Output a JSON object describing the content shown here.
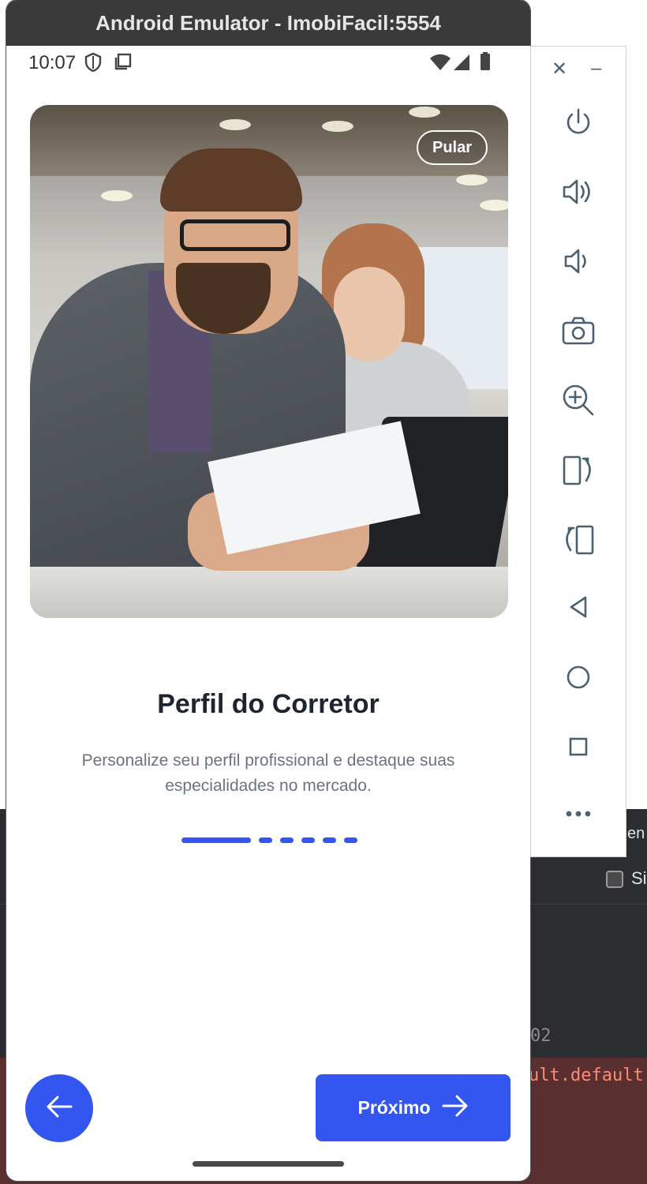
{
  "window": {
    "title": "Android Emulator - ImobiFacil:5554"
  },
  "status_bar": {
    "time": "10:07"
  },
  "onboarding": {
    "skip_label": "Pular",
    "title": "Perfil do Corretor",
    "subtitle": "Personalize seu perfil profissional e destaque suas especialidades no mercado.",
    "page_indicator": {
      "current": 1,
      "total": 6
    },
    "next_label": "Próximo"
  },
  "emulator_toolbar": {
    "icons": [
      "close-icon",
      "minimize-icon",
      "power-icon",
      "volume-up-icon",
      "volume-down-icon",
      "camera-icon",
      "zoom-in-icon",
      "rotate-left-icon",
      "rotate-right-icon",
      "back-icon",
      "home-icon",
      "overview-icon",
      "more-icon"
    ]
  },
  "background_ide": {
    "checkbox_label": "Si",
    "top_text": "en",
    "line_number": "02",
    "error_text": "ult.default')"
  },
  "colors": {
    "accent": "#3355f0",
    "title_text": "#1f2433",
    "subtitle_text": "#6b7280",
    "titlebar_bg": "#3a3a3a"
  }
}
